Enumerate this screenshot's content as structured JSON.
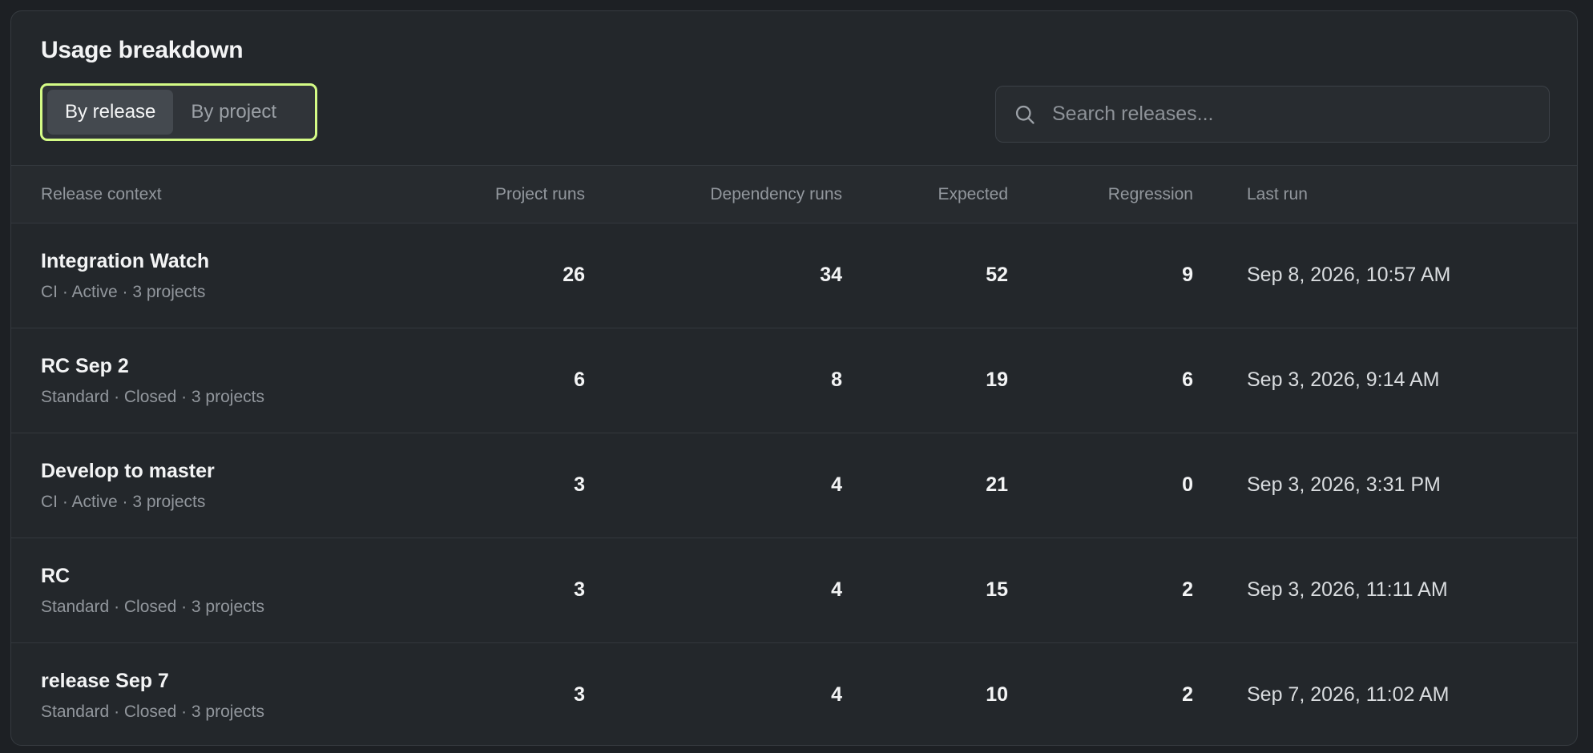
{
  "panel": {
    "title": "Usage breakdown"
  },
  "view_toggle": {
    "options": [
      {
        "label": "By release",
        "active": true
      },
      {
        "label": "By project",
        "active": false
      }
    ],
    "focus_color": "#d4fb86"
  },
  "search": {
    "placeholder": "Search releases...",
    "value": "",
    "icon": "search-icon"
  },
  "table": {
    "columns": [
      "Release context",
      "Project runs",
      "Dependency runs",
      "Expected",
      "Regression",
      "Last run"
    ],
    "rows": [
      {
        "name": "Integration Watch",
        "meta": "CI · Active · 3 projects",
        "project_runs": "26",
        "dependency_runs": "34",
        "expected": "52",
        "regression": "9",
        "last_run": "Sep 8, 2026, 10:57 AM"
      },
      {
        "name": "RC Sep 2",
        "meta": "Standard · Closed · 3 projects",
        "project_runs": "6",
        "dependency_runs": "8",
        "expected": "19",
        "regression": "6",
        "last_run": "Sep 3, 2026, 9:14 AM"
      },
      {
        "name": "Develop to master",
        "meta": "CI · Active · 3 projects",
        "project_runs": "3",
        "dependency_runs": "4",
        "expected": "21",
        "regression": "0",
        "last_run": "Sep 3, 2026, 3:31 PM"
      },
      {
        "name": "RC",
        "meta": "Standard · Closed · 3 projects",
        "project_runs": "3",
        "dependency_runs": "4",
        "expected": "15",
        "regression": "2",
        "last_run": "Sep 3, 2026, 11:11 AM"
      },
      {
        "name": "release Sep 7",
        "meta": "Standard · Closed · 3 projects",
        "project_runs": "3",
        "dependency_runs": "4",
        "expected": "10",
        "regression": "2",
        "last_run": "Sep 7, 2026, 11:02 AM"
      }
    ]
  },
  "colors": {
    "background": "#1d2024",
    "panel": "#23272b",
    "header_row": "#272b2f",
    "accent_focus": "#d4fb86"
  }
}
